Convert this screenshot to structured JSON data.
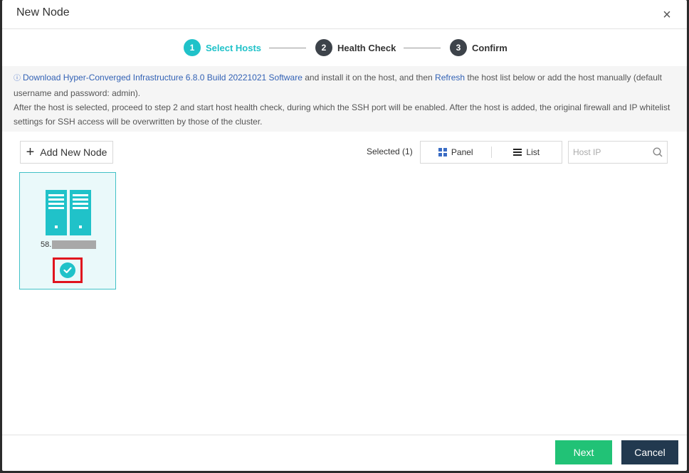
{
  "dialog": {
    "title": "New Node",
    "close_label": "×"
  },
  "steps": [
    {
      "number": "1",
      "label": "Select Hosts",
      "state": "active"
    },
    {
      "number": "2",
      "label": "Health Check",
      "state": "pending"
    },
    {
      "number": "3",
      "label": "Confirm",
      "state": "pending"
    }
  ],
  "notice": {
    "icon": "info-icon",
    "link_download": "Download Hyper-Converged Infrastructure 6.8.0 Build 20221021 Software",
    "text_after_download": " and install it on the host, and then ",
    "link_refresh": "Refresh",
    "text_after_refresh": " the host list below or add the host manually (default username and password: admin).",
    "line2": "After the host is selected, proceed to step 2 and start host health check, during which the SSH port will be enabled. After the host is added, the original firewall and IP whitelist settings for SSH access will be overwritten by those of the cluster."
  },
  "toolbar": {
    "add_label": "Add New Node",
    "selected_text": "Selected (1)",
    "view_panel": "Panel",
    "view_list": "List",
    "search_placeholder": "Host IP"
  },
  "hosts": [
    {
      "ip_prefix": "58.",
      "selected": true
    }
  ],
  "footer": {
    "next_label": "Next",
    "cancel_label": "Cancel"
  },
  "colors": {
    "accent": "#20c2c9",
    "next": "#21c276",
    "cancel": "#22394f",
    "highlight": "#e0141e"
  }
}
